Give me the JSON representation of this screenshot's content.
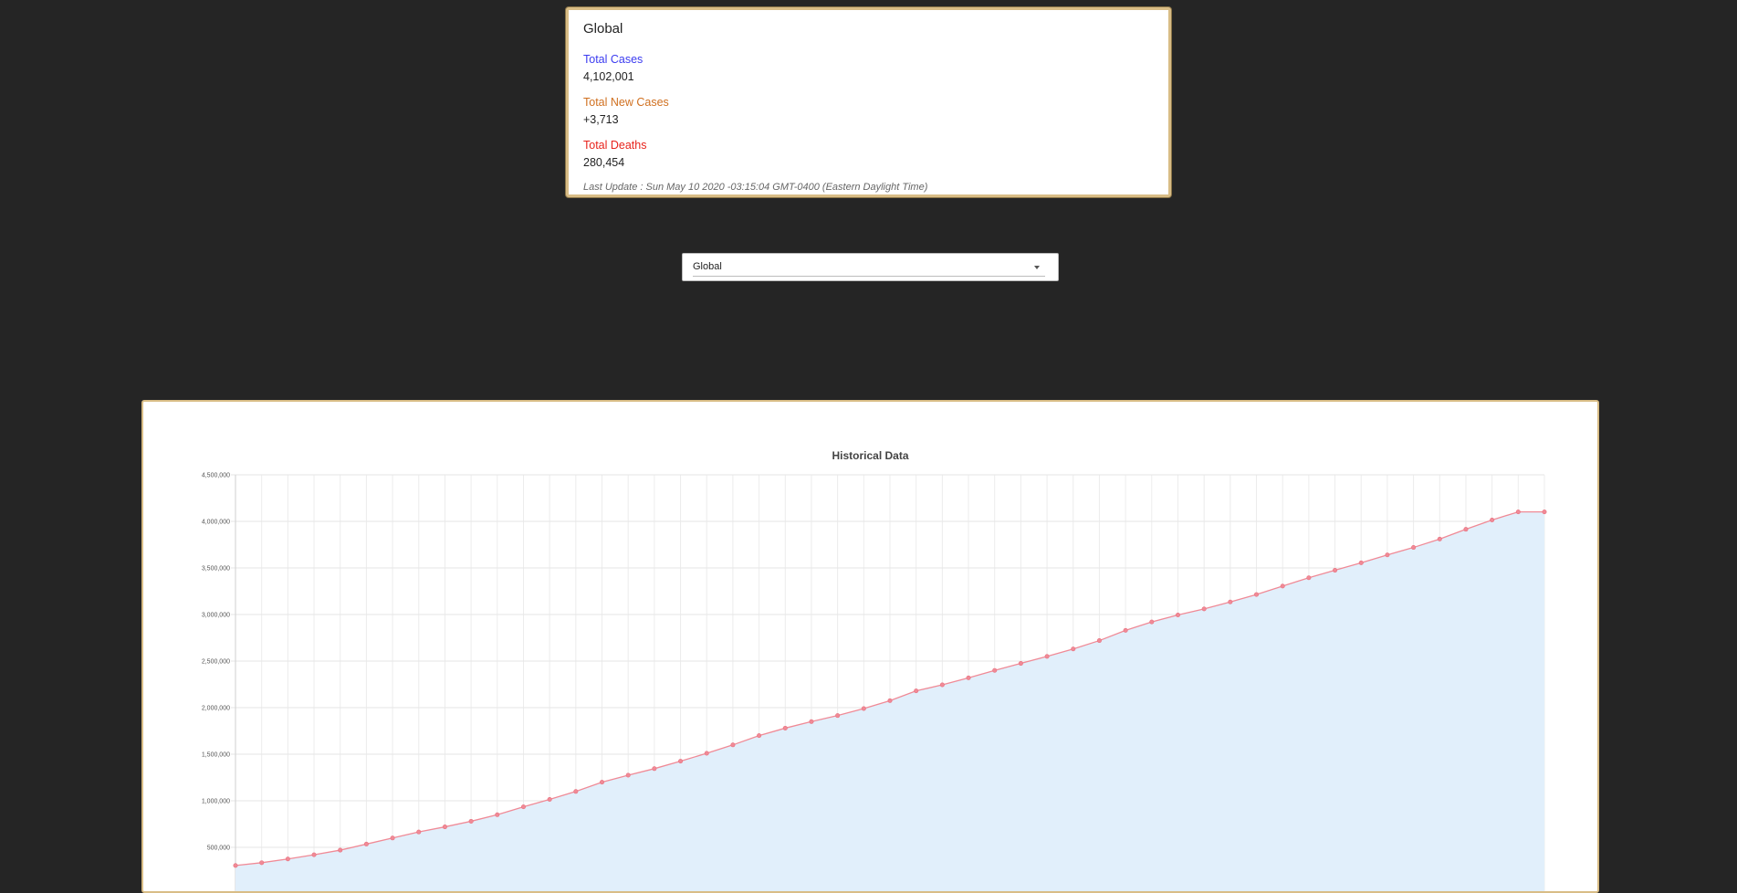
{
  "stats": {
    "title": "Global",
    "total_cases_label": "Total Cases",
    "total_cases_value": "4,102,001",
    "total_new_cases_label": "Total New Cases",
    "total_new_cases_value": "+3,713",
    "total_deaths_label": "Total Deaths",
    "total_deaths_value": "280,454",
    "last_update": "Last Update : Sun May 10 2020 -03:15:04 GMT-0400 (Eastern Daylight Time)"
  },
  "colors": {
    "cases": "#3b3bf0",
    "new_cases": "#d07020",
    "deaths": "#e8231c",
    "line": "#f08a96",
    "fill": "#e1effb",
    "card_border": "#d9bd86"
  },
  "dropdown": {
    "selected": "Global",
    "icon": "chevron-down-icon"
  },
  "chart_data": {
    "type": "area",
    "title": "Historical Data",
    "xlabel": "",
    "ylabel": "",
    "ylim": [
      0,
      4500000
    ],
    "y_ticks": [
      500000,
      1000000,
      1500000,
      2000000,
      2500000,
      3000000,
      3500000,
      4000000,
      4500000
    ],
    "y_tick_labels": [
      "500,000",
      "1,000,000",
      "1,500,000",
      "2,000,000",
      "2,500,000",
      "3,000,000",
      "3,500,000",
      "4,000,000",
      "4,500,000"
    ],
    "grid": true,
    "legend": "none",
    "series": [
      {
        "values": [
          305000,
          335000,
          375000,
          420000,
          470000,
          535000,
          600000,
          665000,
          720000,
          780000,
          850000,
          935000,
          1015000,
          1100000,
          1200000,
          1275000,
          1345000,
          1425000,
          1510000,
          1600000,
          1700000,
          1780000,
          1850000,
          1915000,
          1990000,
          2075000,
          2180000,
          2245000,
          2320000,
          2400000,
          2475000,
          2550000,
          2630000,
          2720000,
          2830000,
          2920000,
          2995000,
          3060000,
          3135000,
          3215000,
          3305000,
          3395000,
          3475000,
          3555000,
          3640000,
          3720000,
          3810000,
          3915000,
          4015000,
          4102001,
          4102001
        ]
      }
    ]
  }
}
